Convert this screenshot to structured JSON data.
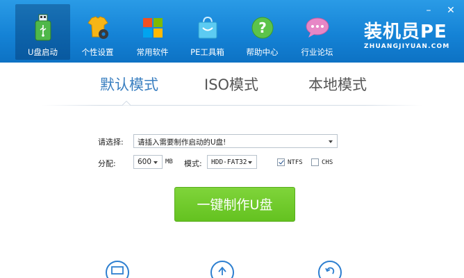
{
  "nav": {
    "items": [
      {
        "label": "U盘启动",
        "icon": "usb-drive-icon"
      },
      {
        "label": "个性设置",
        "icon": "shirt-gear-icon"
      },
      {
        "label": "常用软件",
        "icon": "windows-tiles-icon"
      },
      {
        "label": "PE工具箱",
        "icon": "shopping-bag-icon"
      },
      {
        "label": "帮助中心",
        "icon": "help-question-icon"
      },
      {
        "label": "行业论坛",
        "icon": "chat-bubble-icon"
      }
    ],
    "active_index": 0
  },
  "brand": {
    "name": "装机员PE",
    "url_text": "ZHUANGJIYUAN.COM"
  },
  "window_controls": {
    "minimize": "–",
    "close": "✕"
  },
  "tabs": [
    {
      "label": "默认模式"
    },
    {
      "label": "ISO模式"
    },
    {
      "label": "本地模式"
    }
  ],
  "form": {
    "select_label": "请选择:",
    "device_value": "请插入需要制作启动的U盘!",
    "alloc_label": "分配:",
    "alloc_value": "600",
    "alloc_unit": "MB",
    "mode_label": "模式:",
    "mode_value": "HDD-FAT32",
    "ntfs_label": "NTFS",
    "ntfs_checked": true,
    "chs_label": "CHS",
    "chs_checked": false
  },
  "main_button": {
    "label": "一键制作U盘"
  },
  "bottom_icons": [
    "monitor-icon",
    "upload-icon",
    "restore-icon"
  ],
  "colors": {
    "header": "#1583d6",
    "accent_green": "#64c220",
    "tab_active": "#3a7fc0"
  }
}
